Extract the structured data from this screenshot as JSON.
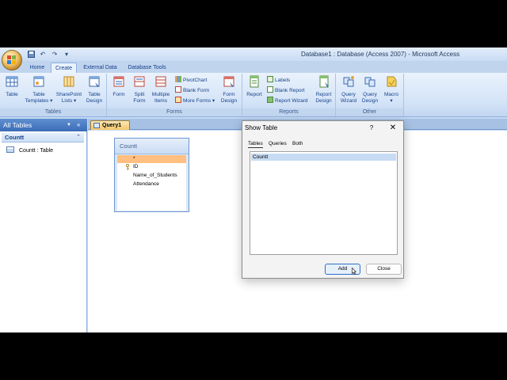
{
  "window": {
    "title": "Database1 : Database (Access 2007) - Microsoft Access"
  },
  "qat": {
    "icons": [
      "save-icon",
      "undo-icon",
      "redo-icon",
      "customize-icon"
    ]
  },
  "ribbon_tabs": [
    {
      "label": "Home",
      "active": false
    },
    {
      "label": "Create",
      "active": true
    },
    {
      "label": "External Data",
      "active": false
    },
    {
      "label": "Database Tools",
      "active": false
    }
  ],
  "ribbon": {
    "tables": {
      "label": "Tables",
      "table": "Table",
      "table_templates_1": "Table",
      "table_templates_2": "Templates",
      "sharepoint_1": "SharePoint",
      "sharepoint_2": "Lists",
      "table_design_1": "Table",
      "table_design_2": "Design"
    },
    "forms": {
      "label": "Forms",
      "form": "Form",
      "split_1": "Split",
      "split_2": "Form",
      "multiple_1": "Multiple",
      "multiple_2": "Items",
      "pivotchart": "PivotChart",
      "blank_form": "Blank Form",
      "more_forms": "More Forms",
      "form_design_1": "Form",
      "form_design_2": "Design"
    },
    "reports": {
      "label": "Reports",
      "report": "Report",
      "labels": "Labels",
      "blank_report": "Blank Report",
      "report_wizard": "Report Wizard",
      "report_design_1": "Report",
      "report_design_2": "Design"
    },
    "other": {
      "label": "Other",
      "query_wizard_1": "Query",
      "query_wizard_2": "Wizard",
      "query_design_1": "Query",
      "query_design_2": "Design",
      "macro": "Macro"
    }
  },
  "nav": {
    "header": "All Tables",
    "group": "Countt",
    "item": "Countt : Table"
  },
  "document": {
    "tab": "Query1",
    "field_list": {
      "title": "Countt",
      "fields": [
        "*",
        "ID",
        "Name_of_Students",
        "Attendance"
      ]
    }
  },
  "dialog": {
    "title": "Show Table",
    "help": "?",
    "close": "✕",
    "tabs": [
      "Tables",
      "Queries",
      "Both"
    ],
    "items": [
      "Countt"
    ],
    "add_label": "Add",
    "close_label": "Close"
  }
}
